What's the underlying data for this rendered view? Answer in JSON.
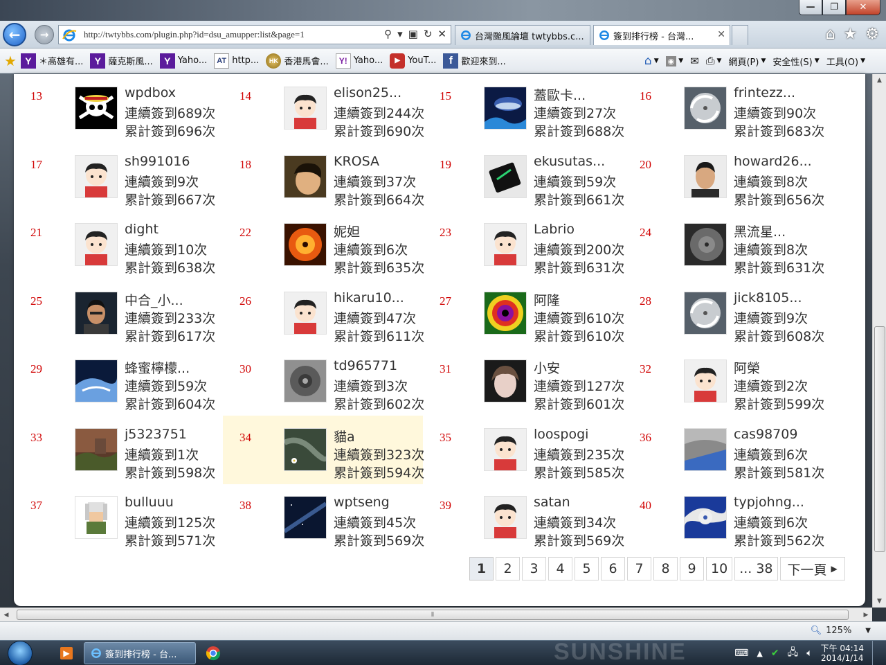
{
  "browser": {
    "address_url": "http://twtybbs.com/plugin.php?id=dsu_amupper:list&page=1",
    "tabs": [
      {
        "label": "台灣颱風論壇 twtybbs.c...",
        "active": false
      },
      {
        "label": "簽到排行榜 - 台灣...",
        "active": true
      }
    ],
    "favorites": [
      {
        "icon": "yahoo",
        "label": "＊高雄有..."
      },
      {
        "icon": "yahoo",
        "label": "薩克斯風..."
      },
      {
        "icon": "yahoo",
        "label": "Yaho..."
      },
      {
        "icon": "at",
        "label": "http..."
      },
      {
        "icon": "hk",
        "label": "香港馬會..."
      },
      {
        "icon": "yah2",
        "label": "Yaho..."
      },
      {
        "icon": "yt",
        "label": "YouT..."
      },
      {
        "icon": "fb",
        "label": "歡迎來到..."
      }
    ],
    "commands": {
      "page": "網頁(P)",
      "safety": "安全性(S)",
      "tools": "工具(O)"
    },
    "zoom": "125%"
  },
  "ranking": {
    "rows": [
      [
        {
          "rank": "13",
          "name": "wpdbox",
          "consecutive": "連續簽到689次",
          "total": "累計簽到696次",
          "avatar": "skull"
        },
        {
          "rank": "14",
          "name": "elison25...",
          "consecutive": "連續簽到244次",
          "total": "累計簽到690次",
          "avatar": "default"
        },
        {
          "rank": "15",
          "name": "蓋歐卡...",
          "consecutive": "連續簽到27次",
          "total": "累計簽到688次",
          "avatar": "whale"
        },
        {
          "rank": "16",
          "name": "frintezz...",
          "consecutive": "連續簽到90次",
          "total": "累計簽到683次",
          "avatar": "storm-white"
        }
      ],
      [
        {
          "rank": "17",
          "name": "sh991016",
          "consecutive": "連續簽到9次",
          "total": "累計簽到667次",
          "avatar": "default"
        },
        {
          "rank": "18",
          "name": "KROSA",
          "consecutive": "連續簽到37次",
          "total": "累計簽到664次",
          "avatar": "photo-boy"
        },
        {
          "rank": "19",
          "name": "ekusutas...",
          "consecutive": "連續簽到59次",
          "total": "累計簽到661次",
          "avatar": "phone"
        },
        {
          "rank": "20",
          "name": "howard26...",
          "consecutive": "連續簽到8次",
          "total": "累計簽到656次",
          "avatar": "photo-man"
        }
      ],
      [
        {
          "rank": "21",
          "name": "dight",
          "consecutive": "連續簽到10次",
          "total": "累計簽到638次",
          "avatar": "default"
        },
        {
          "rank": "22",
          "name": "妮妲",
          "consecutive": "連續簽到6次",
          "total": "累計簽到635次",
          "avatar": "storm-orange"
        },
        {
          "rank": "23",
          "name": "Labrio",
          "consecutive": "連續簽到200次",
          "total": "累計簽到631次",
          "avatar": "default"
        },
        {
          "rank": "24",
          "name": "黑流星...",
          "consecutive": "連續簽到8次",
          "total": "累計簽到631次",
          "avatar": "storm-gray"
        }
      ],
      [
        {
          "rank": "25",
          "name": "中合_小...",
          "consecutive": "連續簽到233次",
          "total": "累計簽到617次",
          "avatar": "photo-dark"
        },
        {
          "rank": "26",
          "name": "hikaru10...",
          "consecutive": "連續簽到47次",
          "total": "累計簽到611次",
          "avatar": "default"
        },
        {
          "rank": "27",
          "name": "阿隆",
          "consecutive": "連續簽到610次",
          "total": "累計簽到610次",
          "avatar": "storm-rainbow"
        },
        {
          "rank": "28",
          "name": "jick8105...",
          "consecutive": "連續簽到9次",
          "total": "累計簽到608次",
          "avatar": "storm-white"
        }
      ],
      [
        {
          "rank": "29",
          "name": "蜂蜜檸檬...",
          "consecutive": "連續簽到59次",
          "total": "累計簽到604次",
          "avatar": "anime-blue"
        },
        {
          "rank": "30",
          "name": "td965771",
          "consecutive": "連續簽到3次",
          "total": "累計簽到602次",
          "avatar": "storm-eye"
        },
        {
          "rank": "31",
          "name": "小安",
          "consecutive": "連續簽到127次",
          "total": "累計簽到601次",
          "avatar": "anime-girl"
        },
        {
          "rank": "32",
          "name": "阿榮",
          "consecutive": "連續簽到2次",
          "total": "累計簽到599次",
          "avatar": "default"
        }
      ],
      [
        {
          "rank": "33",
          "name": "j5323751",
          "consecutive": "連續簽到1次",
          "total": "累計簽到598次",
          "avatar": "landscape"
        },
        {
          "rank": "34",
          "name": "貓a",
          "consecutive": "連續簽到323次",
          "total": "累計簽到594次",
          "avatar": "flower",
          "highlight": true
        },
        {
          "rank": "35",
          "name": "loospogi",
          "consecutive": "連續簽到235次",
          "total": "累計簽到585次",
          "avatar": "default"
        },
        {
          "rank": "36",
          "name": "cas98709",
          "consecutive": "連續簽到6次",
          "total": "累計簽到581次",
          "avatar": "tunnel"
        }
      ],
      [
        {
          "rank": "37",
          "name": "bulluuu",
          "consecutive": "連續簽到125次",
          "total": "累計簽到571次",
          "avatar": "pixel-char"
        },
        {
          "rank": "38",
          "name": "wptseng",
          "consecutive": "連續簽到45次",
          "total": "累計簽到569次",
          "avatar": "night-sky"
        },
        {
          "rank": "39",
          "name": "satan",
          "consecutive": "連續簽到34次",
          "total": "累計簽到569次",
          "avatar": "default"
        },
        {
          "rank": "40",
          "name": "typjohng...",
          "consecutive": "連續簽到6次",
          "total": "累計簽到562次",
          "avatar": "satellite"
        }
      ]
    ]
  },
  "pagination": {
    "pages": [
      "1",
      "2",
      "3",
      "4",
      "5",
      "6",
      "7",
      "8",
      "9",
      "10",
      "... 38"
    ],
    "current": "1",
    "next_label": "下一頁"
  },
  "taskbar": {
    "ie_label": "簽到排行榜 - 台...",
    "clock_time": "下午 04:14",
    "clock_date": "2014/1/14"
  },
  "wallpaper_text": "SUNSHINE"
}
